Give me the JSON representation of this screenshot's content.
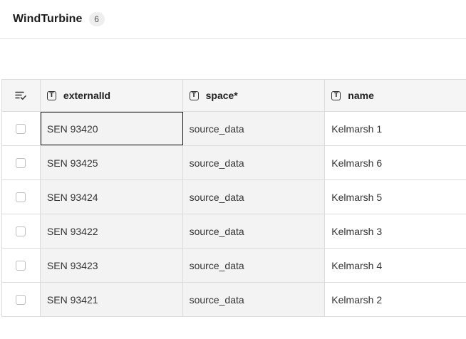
{
  "header": {
    "title": "WindTurbine",
    "count": "6"
  },
  "table": {
    "columns": [
      {
        "key": "externalId",
        "label": "externalId",
        "type_icon": "text-type-icon",
        "type_glyph": "T"
      },
      {
        "key": "space",
        "label": "space*",
        "type_icon": "text-type-icon",
        "type_glyph": "T"
      },
      {
        "key": "name",
        "label": "name",
        "type_icon": "text-type-icon",
        "type_glyph": "T"
      }
    ],
    "select_column_icon": "list-check-icon",
    "rows": [
      {
        "externalId": "SEN 93420",
        "space": "source_data",
        "name": "Kelmarsh 1"
      },
      {
        "externalId": "SEN 93425",
        "space": "source_data",
        "name": "Kelmarsh 6"
      },
      {
        "externalId": "SEN 93424",
        "space": "source_data",
        "name": "Kelmarsh 5"
      },
      {
        "externalId": "SEN 93422",
        "space": "source_data",
        "name": "Kelmarsh 3"
      },
      {
        "externalId": "SEN 93423",
        "space": "source_data",
        "name": "Kelmarsh 4"
      },
      {
        "externalId": "SEN 93421",
        "space": "source_data",
        "name": "Kelmarsh 2"
      }
    ]
  }
}
